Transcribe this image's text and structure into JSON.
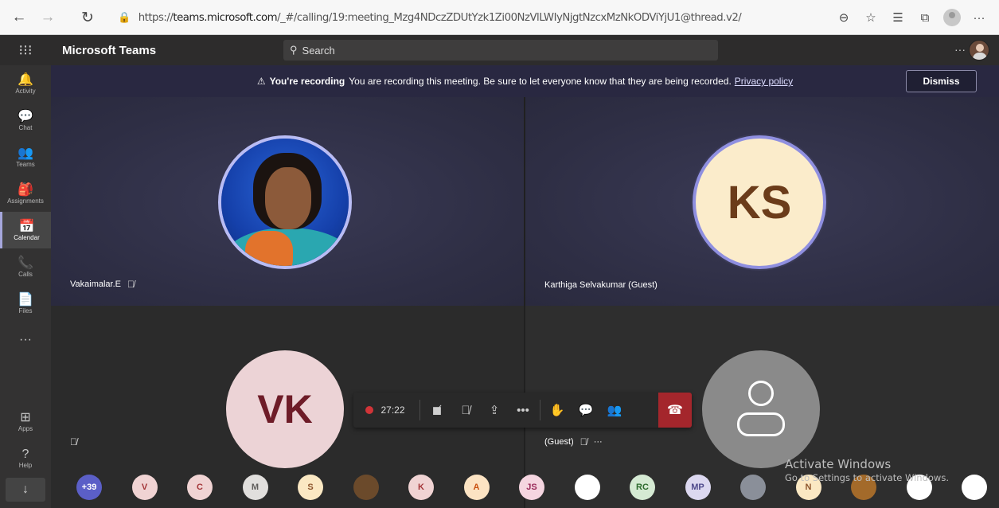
{
  "browser": {
    "url_prefix": "https://",
    "url_host": "teams.microsoft.com",
    "url_path": "/_#/calling/19:meeting_Mzg4NDczZDUtYzk1Zi00NzVlLWIyNjgtNzcxMzNkODViYjU1@thread.v2/"
  },
  "teams": {
    "title": "Microsoft Teams",
    "search_placeholder": "Search",
    "more": "···"
  },
  "rail": [
    {
      "label": "Activity",
      "icon": "bell-icon",
      "glyph": "🔔"
    },
    {
      "label": "Chat",
      "icon": "chat-icon",
      "glyph": "💬"
    },
    {
      "label": "Teams",
      "icon": "teams-icon",
      "glyph": "👥"
    },
    {
      "label": "Assignments",
      "icon": "assignments-icon",
      "glyph": "🎒"
    },
    {
      "label": "Calendar",
      "icon": "calendar-icon",
      "glyph": "📅"
    },
    {
      "label": "Calls",
      "icon": "phone-icon",
      "glyph": "📞"
    },
    {
      "label": "Files",
      "icon": "file-icon",
      "glyph": "📄"
    },
    {
      "label": "",
      "icon": "more-icon",
      "glyph": "···"
    },
    {
      "label": "Apps",
      "icon": "apps-icon",
      "glyph": "⊞"
    },
    {
      "label": "Help",
      "icon": "help-icon",
      "glyph": "?"
    }
  ],
  "banner": {
    "bold": "You're recording",
    "text": "You are recording this meeting. Be sure to let everyone know that they are being recorded.",
    "link": "Privacy policy",
    "dismiss": "Dismiss"
  },
  "tiles": {
    "t1_name": "Vakaimalar.E",
    "t2_initials": "KS",
    "t2_name": "Karthiga Selvakumar (Guest)",
    "t3_initials": "VK",
    "t4_name": "(Guest)",
    "t4_more": "···"
  },
  "controls": {
    "timer": "27:22"
  },
  "participants": [
    {
      "label": "+39",
      "bg": "#5b5fc7",
      "fg": "#ffffff"
    },
    {
      "label": "V",
      "bg": "#f0d3d3",
      "fg": "#a4373a"
    },
    {
      "label": "C",
      "bg": "#f0d3d3",
      "fg": "#a4373a"
    },
    {
      "label": "M",
      "bg": "#e1dfdd",
      "fg": "#605e5c"
    },
    {
      "label": "S",
      "bg": "#fbe8c3",
      "fg": "#8e562e"
    },
    {
      "label": "",
      "bg": "#6b4a2b",
      "fg": "#ffffff"
    },
    {
      "label": "K",
      "bg": "#f0d3d3",
      "fg": "#a4373a"
    },
    {
      "label": "A",
      "bg": "#fce3c3",
      "fg": "#ca5010"
    },
    {
      "label": "JS",
      "bg": "#f5d5e0",
      "fg": "#9a2a5a"
    },
    {
      "label": "",
      "bg": "#ffffff",
      "fg": "#d13438"
    },
    {
      "label": "RC",
      "bg": "#d5ead3",
      "fg": "#2d6a2d"
    },
    {
      "label": "MP",
      "bg": "#dcd8f0",
      "fg": "#4f4a8c"
    },
    {
      "label": "",
      "bg": "#8a8f99",
      "fg": "#ffffff"
    },
    {
      "label": "N",
      "bg": "#fbe8c3",
      "fg": "#8e562e"
    },
    {
      "label": "",
      "bg": "#a36a2a",
      "fg": "#ffffff"
    },
    {
      "label": "",
      "bg": "#ffffff",
      "fg": "#d13438"
    },
    {
      "label": "",
      "bg": "#ffffff",
      "fg": "#d13438"
    }
  ],
  "watermark": {
    "line1": "Activate Windows",
    "line2": "Go to Settings to activate Windows."
  }
}
